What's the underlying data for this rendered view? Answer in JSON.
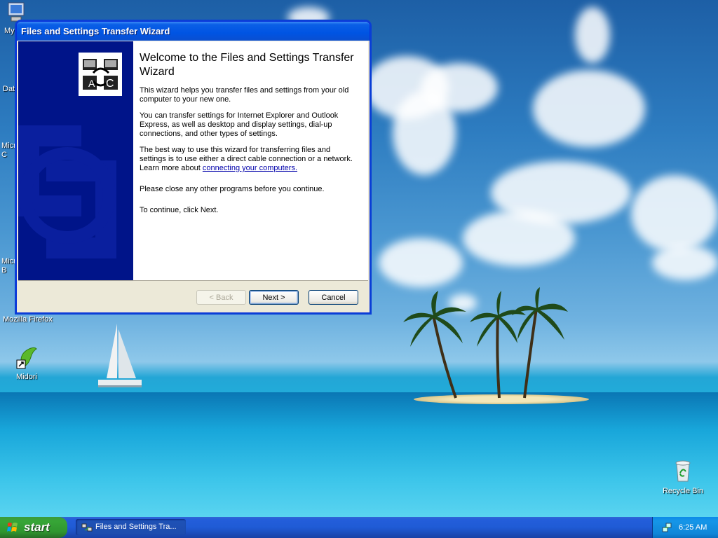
{
  "desktop": {
    "icons": [
      {
        "label": "My",
        "name": "my-computer-icon"
      },
      {
        "label": "Dat",
        "name": "data-icon"
      },
      {
        "label": "Micr\nC",
        "name": "microsoft-icon-1"
      },
      {
        "label": "Micr\nB",
        "name": "microsoft-icon-2"
      },
      {
        "label": "Mozilla Firefox",
        "name": "mozilla-firefox-icon"
      },
      {
        "label": "Midori",
        "name": "midori-icon"
      },
      {
        "label": "Recycle Bin",
        "name": "recycle-bin-icon"
      }
    ]
  },
  "wizard": {
    "title": "Files and Settings Transfer Wizard",
    "heading": "Welcome to the Files and Settings Transfer Wizard",
    "para1": "This wizard helps you transfer files and settings from your old computer to your new one.",
    "para2": "You can transfer settings for Internet Explorer and Outlook Express, as well as desktop and display settings, dial-up connections, and other types of settings.",
    "para3_prefix": "The best way to use this wizard for transferring files and settings is to use either a direct cable connection or a network. Learn more about ",
    "para3_link": "connecting your computers.",
    "para4": "Please close any other programs before you continue.",
    "para5": "To continue, click Next.",
    "buttons": {
      "back": "< Back",
      "next": "Next >",
      "cancel": "Cancel"
    }
  },
  "taskbar": {
    "start_label": "start",
    "task_label": "Files and Settings Tra...",
    "clock": "6:25 AM"
  },
  "colors": {
    "titlebar": "#0054e3",
    "side_panel": "#001489",
    "start_button": "#37a637",
    "tray": "#0f86d8"
  }
}
